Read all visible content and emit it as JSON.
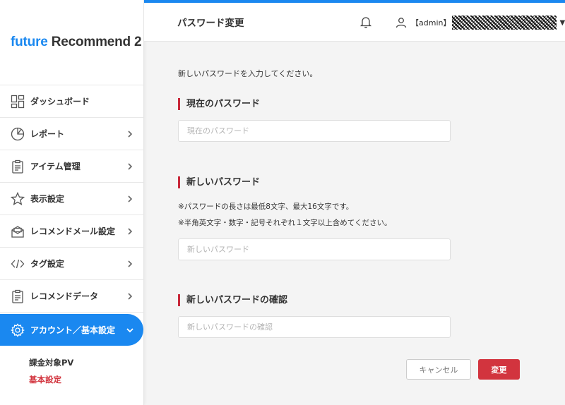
{
  "brand": {
    "part1": "future",
    "part2": " Recommend 2"
  },
  "sidebar": {
    "items": [
      {
        "label": "ダッシュボード",
        "icon": "dashboard-icon"
      },
      {
        "label": "レポート",
        "icon": "pie-chart-icon"
      },
      {
        "label": "アイテム管理",
        "icon": "clipboard-icon"
      },
      {
        "label": "表示設定",
        "icon": "star-icon"
      },
      {
        "label": "レコメンドメール設定",
        "icon": "mail-icon"
      },
      {
        "label": "タグ設定",
        "icon": "code-icon"
      },
      {
        "label": "レコメンドデータ",
        "icon": "clipboard-icon"
      },
      {
        "label": "アカウント／基本設定",
        "icon": "gear-icon"
      }
    ],
    "subitems": [
      {
        "label": "課金対象PV"
      },
      {
        "label": "基本設定"
      }
    ]
  },
  "header": {
    "title": "パスワード変更",
    "user": "【admin】"
  },
  "main": {
    "intro": "新しいパスワードを入力してください。",
    "current": {
      "title": "現在のパスワード",
      "placeholder": "現在のパスワード"
    },
    "new": {
      "title": "新しいパスワード",
      "note1": "※パスワードの長さは最低8文字、最大16文字です。",
      "note2": "※半角英文字・数字・記号それぞれ１文字以上含めてください。",
      "placeholder": "新しいパスワード"
    },
    "confirm": {
      "title": "新しいパスワードの確認",
      "placeholder": "新しいパスワードの確認"
    },
    "cancel_label": "キャンセル",
    "submit_label": "変更"
  },
  "colors": {
    "accent": "#1a88f0",
    "danger": "#d2343e"
  }
}
